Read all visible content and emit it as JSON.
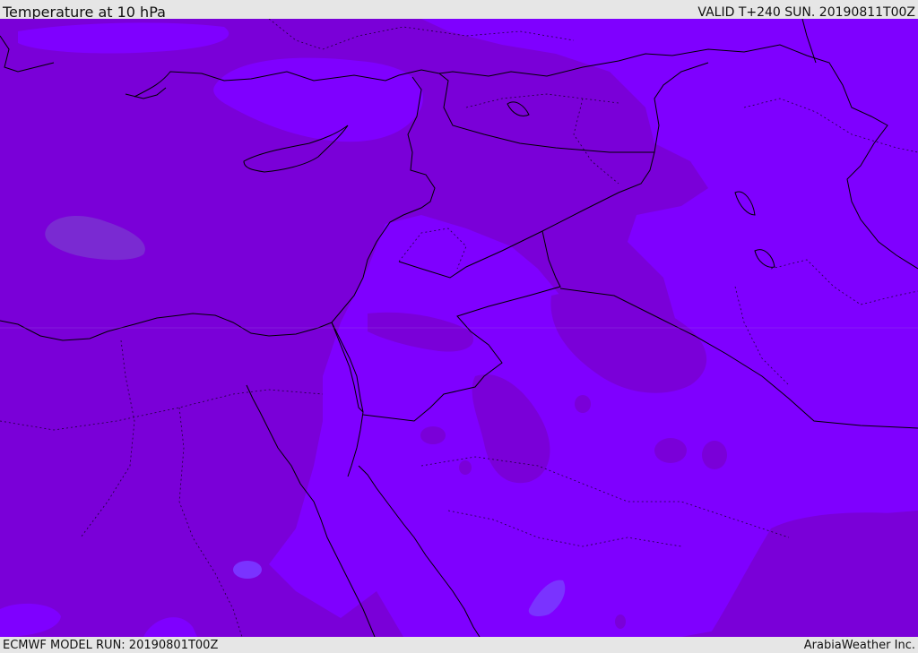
{
  "header": {
    "title": "Temperature at 10 hPa",
    "valid": "VALID T+240 SUN. 20190811T00Z"
  },
  "footer": {
    "model_run": "ECMWF MODEL RUN: 20190801T00Z",
    "credit": "ArabiaWeather Inc."
  },
  "colors": {
    "background_bar": "#e6e6e6",
    "field_base": "#7a00d8",
    "field_warm_band": "#7f00ff",
    "field_coldest_pocket": "#7a2ad2",
    "field_warmest_pocket": "#7a33ff",
    "coastline": "#000000",
    "border": "#000000"
  }
}
